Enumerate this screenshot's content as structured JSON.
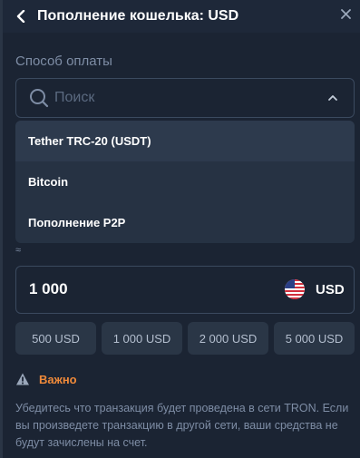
{
  "header": {
    "title": "Пополнение кошелька: USD",
    "back_icon": "chevron-left-icon",
    "close_icon": "close-icon"
  },
  "payment": {
    "section_label": "Способ оплаты",
    "search_placeholder": "Поиск",
    "options": [
      {
        "label": "Tether TRC-20 (USDT)",
        "active": true
      },
      {
        "label": "Bitcoin",
        "active": false
      },
      {
        "label": "Пополнение P2P",
        "active": false
      }
    ]
  },
  "amount": {
    "approx_symbol": "≈",
    "value": "1 000",
    "currency": "USD",
    "flag_icon": "us-flag-icon"
  },
  "quick_amounts": [
    "500 USD",
    "1 000 USD",
    "2 000 USD",
    "5 000 USD"
  ],
  "warning": {
    "title": "Важно",
    "text": "Убедитесь что транзакция будет проведена в сети TRON. Если вы произведете транзакцию в другой сети, ваши средства не будут зачислены на счет."
  },
  "colors": {
    "background": "#1b2433",
    "accent_warning": "#f08a3a",
    "muted_text": "#7e8da5"
  }
}
